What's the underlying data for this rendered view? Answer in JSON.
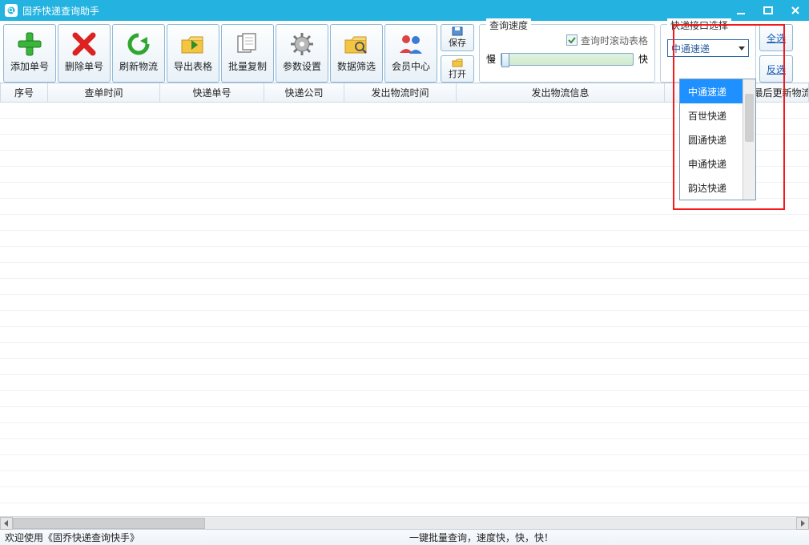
{
  "window": {
    "title": "固乔快递查询助手"
  },
  "toolbar": {
    "add": "添加单号",
    "del": "删除单号",
    "refresh": "刷新物流",
    "export": "导出表格",
    "batchcopy": "批量复制",
    "params": "参数设置",
    "filter": "数据筛选",
    "member": "会员中心",
    "save": "保存",
    "open": "打开"
  },
  "speed": {
    "legend": "查询速度",
    "checkbox": "查询时滚动表格",
    "slow": "慢",
    "fast": "快"
  },
  "api": {
    "legend": "快递接口选择",
    "selected": "中通速递",
    "options": [
      "中通速递",
      "百世快递",
      "圆通快递",
      "申通快递",
      "韵达快递"
    ]
  },
  "selbtns": {
    "all": "全选",
    "invert": "反选"
  },
  "columns": [
    "序号",
    "查单时间",
    "快递单号",
    "快递公司",
    "发出物流时间",
    "发出物流信息",
    "最后",
    "最后更新物流"
  ],
  "status": {
    "left": "欢迎使用《固乔快递查询快手》",
    "right": "一键批量查询，速度快，快，快！"
  }
}
